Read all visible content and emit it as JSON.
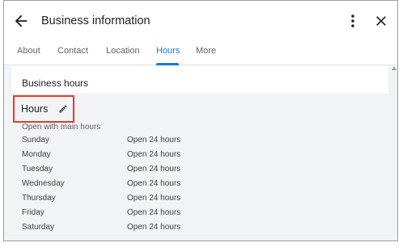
{
  "header": {
    "title": "Business information"
  },
  "tabs": [
    {
      "label": "About"
    },
    {
      "label": "Contact"
    },
    {
      "label": "Location"
    },
    {
      "label": "Hours",
      "active": true
    },
    {
      "label": "More"
    }
  ],
  "colors": {
    "accent": "#1a73e8",
    "highlight_box": "#e53935"
  },
  "section": {
    "title": "Business hours"
  },
  "hours": {
    "heading": "Hours",
    "subtitle": "Open with main hours",
    "rows": [
      {
        "day": "Sunday",
        "value": "Open 24 hours"
      },
      {
        "day": "Monday",
        "value": "Open 24 hours"
      },
      {
        "day": "Tuesday",
        "value": "Open 24 hours"
      },
      {
        "day": "Wednesday",
        "value": "Open 24 hours"
      },
      {
        "day": "Thursday",
        "value": "Open 24 hours"
      },
      {
        "day": "Friday",
        "value": "Open 24 hours"
      },
      {
        "day": "Saturday",
        "value": "Open 24 hours"
      }
    ]
  },
  "icons": {
    "back": "arrow-back-icon",
    "more": "more-vert-icon",
    "close": "close-icon",
    "edit": "pencil-icon"
  }
}
